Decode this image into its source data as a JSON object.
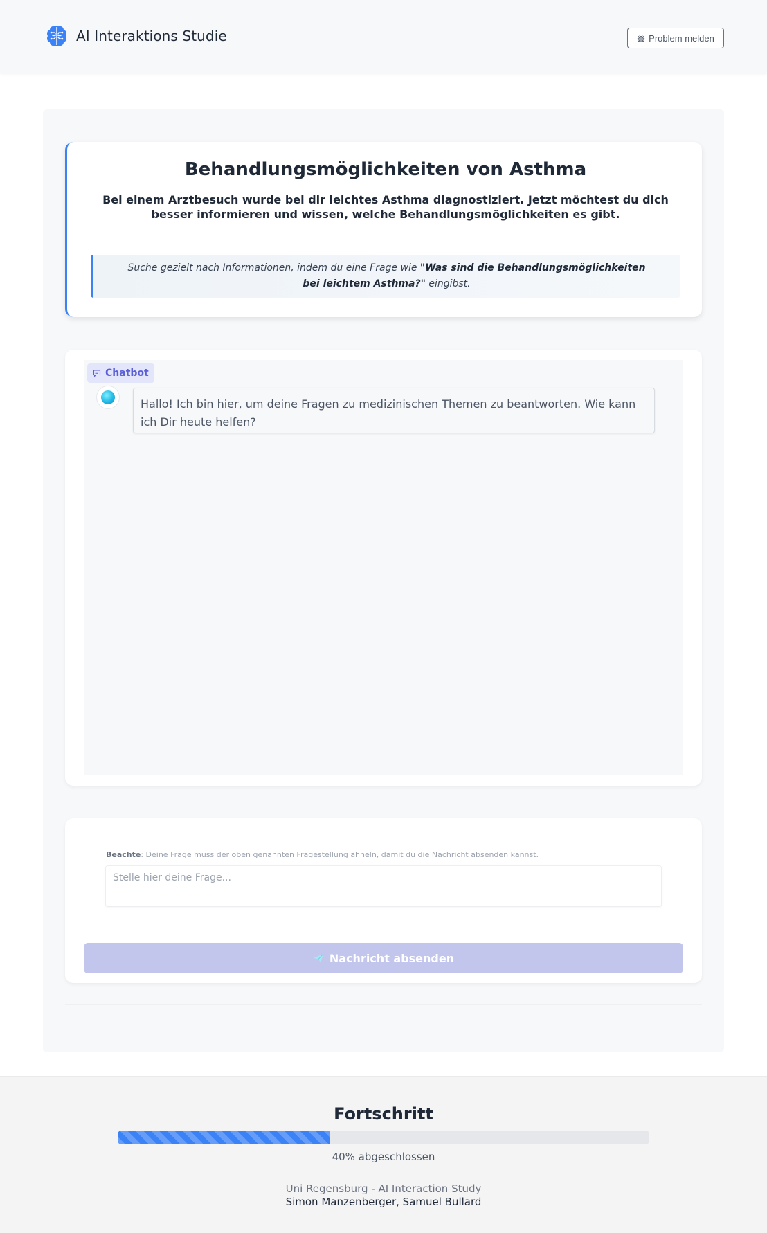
{
  "app": {
    "title": "AI Interaktions Studie",
    "report_button": "Problem melden",
    "brand_color": "#3b82f6"
  },
  "task": {
    "title": "Behandlungsmöglichkeiten von Asthma",
    "description": "Bei einem Arztbesuch wurde bei dir leichtes Asthma diagnostiziert. Jetzt möchtest du dich besser informieren und wissen, welche Behandlungsmöglichkeiten es gibt.",
    "hint_prefix": "Suche gezielt nach Informationen, indem du eine Frage wie ",
    "hint_question": "\"Was sind die Behandlungsmöglichkeiten bei leichtem Asthma?\"",
    "hint_suffix": " eingibst."
  },
  "chat": {
    "tag_label": "Chatbot",
    "messages": [
      {
        "sender": "bot",
        "text": "Hallo! Ich bin hier, um deine Fragen zu medizinischen Themen zu beantworten. Wie kann ich Dir heute helfen?"
      }
    ]
  },
  "composer": {
    "note_label": "Beachte",
    "note_text": ": Deine Frage muss der oben genannten Fragestellung ähneln, damit du die Nachricht absenden kannst.",
    "placeholder": "Stelle hier deine Frage...",
    "value": "",
    "send_label": "Nachricht absenden",
    "send_disabled": true,
    "send_color": "#c2c6ed"
  },
  "footer": {
    "progress_title": "Fortschritt",
    "progress_percent": 40,
    "progress_label": "40% abgeschlossen",
    "credit_line1": "Uni Regensburg - AI Interaction Study",
    "credit_line2": "Simon Manzenberger, Samuel Bullard"
  }
}
